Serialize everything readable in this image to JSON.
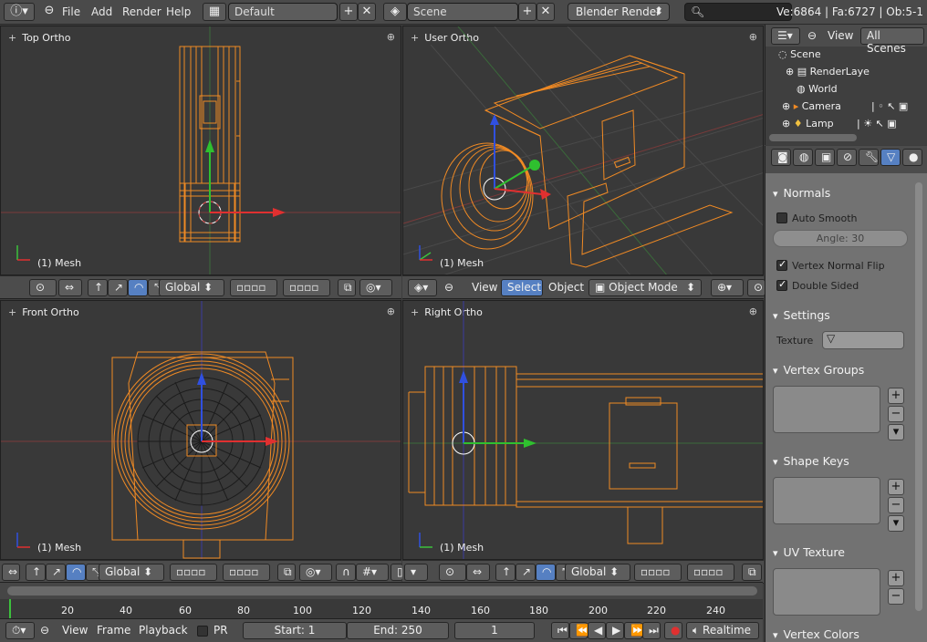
{
  "topbar": {
    "menus": [
      "File",
      "Add",
      "Render",
      "Help"
    ],
    "screen_layout": "Default",
    "scene": "Scene",
    "render_engine": "Blender Render",
    "stats": "Ve:6864 | Fa:6727 | Ob:5-1"
  },
  "viewports": {
    "top_left": {
      "title": "Top Ortho",
      "mesh": "(1) Mesh"
    },
    "top_right": {
      "title": "User Ortho",
      "mesh": "(1) Mesh"
    },
    "bottom_left": {
      "title": "Front Ortho",
      "mesh": "(1) Mesh"
    },
    "bottom_right": {
      "title": "Right Ortho",
      "mesh": "(1) Mesh"
    }
  },
  "header_mid": {
    "orientation": "Global",
    "view": "View",
    "select": "Select",
    "object": "Object",
    "mode": "Object Mode"
  },
  "header_bottom": {
    "orientation_left": "Global",
    "orientation_right": "Global"
  },
  "timeline": {
    "ticks": [
      "20",
      "40",
      "60",
      "80",
      "100",
      "120",
      "140",
      "160",
      "180",
      "200",
      "220",
      "240"
    ],
    "menu_view": "View",
    "menu_frame": "Frame",
    "menu_playback": "Playback",
    "pr": "PR",
    "start": "Start: 1",
    "end": "End: 250",
    "current": "1",
    "sync": "Realtime"
  },
  "outliner": {
    "view": "View",
    "filter": "All Scenes",
    "items": [
      "Scene",
      "RenderLaye",
      "World",
      "Camera",
      "Lamp"
    ]
  },
  "properties": {
    "normals": {
      "header": "Normals",
      "auto_smooth": "Auto Smooth",
      "angle": "Angle: 30",
      "vertex_normal_flip": "Vertex Normal Flip",
      "double_sided": "Double Sided"
    },
    "settings": {
      "header": "Settings",
      "texture_label": "Texture"
    },
    "vertex_groups": "Vertex Groups",
    "shape_keys": "Shape Keys",
    "uv_texture": "UV Texture",
    "vertex_colors": "Vertex Colors"
  },
  "colors": {
    "wire_selected": "#f08a24",
    "axis_x": "#e03030",
    "axis_y": "#30c030",
    "axis_z": "#3050e0",
    "select_highlight": "#5680c2"
  }
}
